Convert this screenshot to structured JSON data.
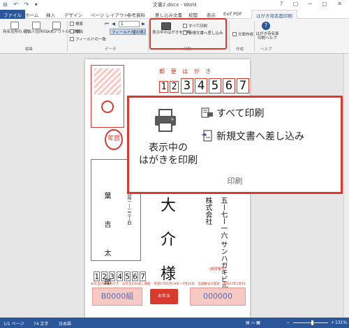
{
  "window": {
    "title": "文書2.docx - Word",
    "quick_access": "⊟ ↶ ↷ ▾"
  },
  "tabs": [
    {
      "label": "ファイル"
    },
    {
      "label": "ホーム"
    },
    {
      "label": "挿入"
    },
    {
      "label": "デザイン"
    },
    {
      "label": "ページ レイアウト"
    },
    {
      "label": "参考資料"
    },
    {
      "label": "差し込み文書"
    },
    {
      "label": "校閲"
    },
    {
      "label": "表示"
    },
    {
      "label": "Exif PDF"
    },
    {
      "label": "はがき宛名面印刷"
    }
  ],
  "ribbon": {
    "edit_group": {
      "label": "編集",
      "buttons": [
        "宛名住所の入力",
        "差出人住所の入力",
        "レイアウトの微調整"
      ]
    },
    "data_group": {
      "label": "データ",
      "search": "検索",
      "extract": "抽出",
      "field_list": "フィールドの一致",
      "record_number": "1",
      "field_toggle": "フィールド/値の表示"
    },
    "print_group": {
      "label": "印刷",
      "print_current": "表示中のはがきを印刷",
      "print_all": "すべて印刷",
      "merge_new": "新規文書へ差し込み"
    },
    "create_group": {
      "label": "作成",
      "button": "文面作成"
    },
    "help_group": {
      "label": "ヘルプ",
      "button": "はがき宛名面印刷ヘルプ"
    }
  },
  "postcard": {
    "header": "郵 便 は が き",
    "postal_code": [
      "1",
      "2",
      "3",
      "4",
      "5",
      "6",
      "7"
    ],
    "nenga": "年賀",
    "recipient_name": "大 介 様",
    "recipient_company": "株式会社",
    "recipient_address": "五ー七ー一六 サンハガキビル",
    "sender_name": "葉 吉 太 郎",
    "sender_address": "東京都千代田区九段一ー二三ー四",
    "sender_postal_code": [
      "1",
      "2",
      "3",
      "4",
      "5",
      "6",
      "7"
    ],
    "notice": "お年玉付郵便はがき　お年玉のお渡し期間　平成27年1月19日～7月20日　当選番号の発表　平成27年1月18日",
    "address_label": "(郵便番号)",
    "lottery_left": "B0000組",
    "lottery_right": "000000",
    "otoshidama": "お年玉"
  },
  "zoom_panel": {
    "print_current": "表示中の\nはがきを印刷",
    "print_all": "すべて印刷",
    "merge_new": "新規文書へ差し込み",
    "group_label": "印刷"
  },
  "status_bar": {
    "page": "1/1 ページ",
    "words": "74 文字",
    "language": "日本語",
    "zoom": "131%"
  },
  "colors": {
    "accent": "#2b579a",
    "highlight": "#d93a2b",
    "postcard_red": "#d93a2b"
  }
}
